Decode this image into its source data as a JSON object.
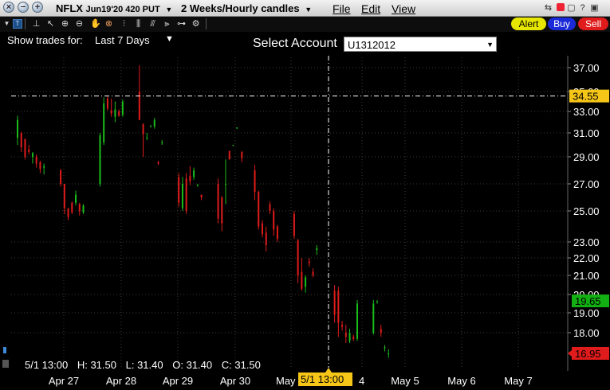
{
  "window": {
    "symbol": "NFLX",
    "contract": "Jun19'20 420 PUT",
    "period": "2 Weeks/Hourly candles",
    "menu": [
      "File",
      "Edit",
      "View"
    ]
  },
  "toolbar": {
    "tools": [
      "text-tool-icon",
      "pointer-icon",
      "zoom-in-icon",
      "zoom-out-icon",
      "hand-icon",
      "crosshair-icon",
      "bars-icon",
      "bars-alt-icon",
      "bars-scale-icon",
      "bars-fit-icon",
      "link-icon",
      "settings-icon"
    ],
    "alert_label": "Alert",
    "buy_label": "Buy",
    "sell_label": "Sell",
    "alert_color": "#e6e600",
    "buy_color": "#1b2ad8",
    "sell_color": "#e01b1b"
  },
  "header": {
    "show_trades_label": "Show trades for:",
    "trades_period": "Last 7 Days",
    "account_label": "Select Account",
    "account_value": "U1312012"
  },
  "crosshair": {
    "price_label": "34.55",
    "time_label": "5/1 13:00"
  },
  "price_badges": {
    "bid": "19.65",
    "bid_color": "#12b012",
    "ask": "16.95",
    "ask_color": "#e01b1b",
    "crosshair_color": "#f5c518"
  },
  "bottom_info": {
    "time": "5/1 13:00",
    "high": "H: 31.50",
    "low": "L: 31.40",
    "open": "O: 31.40",
    "close": "C: 31.50"
  },
  "chart_data": {
    "type": "candlestick",
    "y_ticks": [
      "37.00",
      "35.00",
      "33.00",
      "31.00",
      "29.00",
      "27.00",
      "25.00",
      "23.00",
      "22.00",
      "21.00",
      "20.00",
      "19.00",
      "18.00"
    ],
    "x_ticks": [
      "Apr 27",
      "Apr 28",
      "Apr 29",
      "Apr 30",
      "May",
      "4",
      "May 5",
      "May 6",
      "May 7"
    ],
    "ylim": [
      16.5,
      38.0
    ],
    "up_color": "#1bbd1b",
    "down_color": "#e01b1b",
    "candles": [
      {
        "x": 0.0,
        "o": 30.6,
        "h": 32.6,
        "l": 30.0,
        "c": 32.2
      },
      {
        "x": 0.007,
        "o": 31.0,
        "h": 31.1,
        "l": 29.4,
        "c": 29.8
      },
      {
        "x": 0.014,
        "o": 30.5,
        "h": 30.5,
        "l": 28.8,
        "c": 29.0
      },
      {
        "x": 0.021,
        "o": 29.6,
        "h": 30.0,
        "l": 29.2,
        "c": 29.4
      },
      {
        "x": 0.028,
        "o": 29.0,
        "h": 29.4,
        "l": 28.5,
        "c": 29.3
      },
      {
        "x": 0.035,
        "o": 29.0,
        "h": 29.2,
        "l": 28.2,
        "c": 28.5
      },
      {
        "x": 0.042,
        "o": 28.6,
        "h": 28.7,
        "l": 27.8,
        "c": 28.1
      },
      {
        "x": 0.049,
        "o": 28.2,
        "h": 28.5,
        "l": 27.7,
        "c": 28.3
      },
      {
        "x": 0.08,
        "o": 28.0,
        "h": 28.1,
        "l": 26.8,
        "c": 27.0
      },
      {
        "x": 0.087,
        "o": 27.0,
        "h": 27.0,
        "l": 24.8,
        "c": 25.2
      },
      {
        "x": 0.094,
        "o": 25.2,
        "h": 25.2,
        "l": 24.4,
        "c": 24.6
      },
      {
        "x": 0.101,
        "o": 25.6,
        "h": 25.7,
        "l": 24.8,
        "c": 24.9
      },
      {
        "x": 0.108,
        "o": 25.6,
        "h": 26.5,
        "l": 25.4,
        "c": 26.2
      },
      {
        "x": 0.115,
        "o": 25.5,
        "h": 25.6,
        "l": 24.7,
        "c": 25.0
      },
      {
        "x": 0.122,
        "o": 24.9,
        "h": 25.5,
        "l": 24.8,
        "c": 25.4
      },
      {
        "x": 0.153,
        "o": 27.0,
        "h": 31.0,
        "l": 26.8,
        "c": 30.8
      },
      {
        "x": 0.16,
        "o": 30.2,
        "h": 34.4,
        "l": 30.0,
        "c": 33.8
      },
      {
        "x": 0.167,
        "o": 34.3,
        "h": 34.5,
        "l": 33.1,
        "c": 33.3
      },
      {
        "x": 0.174,
        "o": 33.1,
        "h": 34.3,
        "l": 32.5,
        "c": 32.8
      },
      {
        "x": 0.181,
        "o": 32.5,
        "h": 34.0,
        "l": 32.0,
        "c": 33.2
      },
      {
        "x": 0.188,
        "o": 33.0,
        "h": 33.2,
        "l": 32.5,
        "c": 32.6
      },
      {
        "x": 0.195,
        "o": 32.7,
        "h": 34.2,
        "l": 32.5,
        "c": 34.0
      },
      {
        "x": 0.226,
        "o": 35.0,
        "h": 37.2,
        "l": 32.3,
        "c": 32.2
      },
      {
        "x": 0.233,
        "o": 31.8,
        "h": 31.9,
        "l": 29.0,
        "c": 30.9
      },
      {
        "x": 0.24,
        "o": 30.6,
        "h": 31.0,
        "l": 30.4,
        "c": 30.6
      },
      {
        "x": 0.247,
        "o": 31.7,
        "h": 31.7,
        "l": 31.5,
        "c": 31.7
      },
      {
        "x": 0.254,
        "o": 31.6,
        "h": 32.4,
        "l": 31.4,
        "c": 32.2
      },
      {
        "x": 0.261,
        "o": 28.6,
        "h": 28.7,
        "l": 28.4,
        "c": 28.5
      },
      {
        "x": 0.268,
        "o": 30.2,
        "h": 30.4,
        "l": 30.0,
        "c": 30.2
      },
      {
        "x": 0.299,
        "o": 27.5,
        "h": 27.8,
        "l": 25.3,
        "c": 25.6
      },
      {
        "x": 0.306,
        "o": 25.2,
        "h": 27.5,
        "l": 25.0,
        "c": 27.0
      },
      {
        "x": 0.313,
        "o": 27.4,
        "h": 27.8,
        "l": 24.8,
        "c": 25.0
      },
      {
        "x": 0.32,
        "o": 27.6,
        "h": 28.3,
        "l": 26.9,
        "c": 27.2
      },
      {
        "x": 0.327,
        "o": 27.5,
        "h": 28.2,
        "l": 27.3,
        "c": 28.0
      },
      {
        "x": 0.334,
        "o": 26.9,
        "h": 27.0,
        "l": 26.8,
        "c": 26.9
      },
      {
        "x": 0.341,
        "o": 26.2,
        "h": 26.2,
        "l": 25.8,
        "c": 26.0
      },
      {
        "x": 0.372,
        "o": 27.0,
        "h": 27.4,
        "l": 24.2,
        "c": 24.5
      },
      {
        "x": 0.379,
        "o": 26.0,
        "h": 26.1,
        "l": 23.7,
        "c": 24.2
      },
      {
        "x": 0.386,
        "o": 27.0,
        "h": 28.8,
        "l": 25.5,
        "c": 27.0
      },
      {
        "x": 0.393,
        "o": 29.5,
        "h": 29.5,
        "l": 28.8,
        "c": 28.8
      },
      {
        "x": 0.4,
        "o": 30.0,
        "h": 30.0,
        "l": 29.9,
        "c": 30.0
      },
      {
        "x": 0.407,
        "o": 31.4,
        "h": 31.5,
        "l": 31.4,
        "c": 31.5
      },
      {
        "x": 0.416,
        "o": 29.4,
        "h": 29.5,
        "l": 28.6,
        "c": 28.9
      },
      {
        "x": 0.44,
        "o": 28.0,
        "h": 28.4,
        "l": 25.8,
        "c": 26.4
      },
      {
        "x": 0.447,
        "o": 26.4,
        "h": 26.5,
        "l": 23.8,
        "c": 24.0
      },
      {
        "x": 0.454,
        "o": 24.2,
        "h": 24.4,
        "l": 23.3,
        "c": 23.5
      },
      {
        "x": 0.461,
        "o": 23.6,
        "h": 24.0,
        "l": 22.4,
        "c": 22.8
      },
      {
        "x": 0.468,
        "o": 25.5,
        "h": 25.7,
        "l": 24.8,
        "c": 25.0
      },
      {
        "x": 0.475,
        "o": 25.0,
        "h": 25.2,
        "l": 23.4,
        "c": 23.8
      },
      {
        "x": 0.482,
        "o": 24.0,
        "h": 24.1,
        "l": 23.0,
        "c": 23.2
      },
      {
        "x": 0.513,
        "o": 24.8,
        "h": 25.0,
        "l": 23.2,
        "c": 23.4
      },
      {
        "x": 0.52,
        "o": 23.1,
        "h": 23.2,
        "l": 20.6,
        "c": 21.0
      },
      {
        "x": 0.527,
        "o": 21.2,
        "h": 22.0,
        "l": 20.2,
        "c": 20.3
      },
      {
        "x": 0.534,
        "o": 20.4,
        "h": 21.0,
        "l": 20.1,
        "c": 20.9
      },
      {
        "x": 0.541,
        "o": 21.8,
        "h": 22.0,
        "l": 21.5,
        "c": 21.7
      },
      {
        "x": 0.548,
        "o": 21.2,
        "h": 21.4,
        "l": 20.9,
        "c": 21.0
      },
      {
        "x": 0.555,
        "o": 22.5,
        "h": 22.8,
        "l": 22.2,
        "c": 22.6
      },
      {
        "x": 0.588,
        "o": 20.2,
        "h": 20.5,
        "l": 18.5,
        "c": 18.9
      },
      {
        "x": 0.595,
        "o": 20.2,
        "h": 20.4,
        "l": 17.8,
        "c": 18.5
      },
      {
        "x": 0.602,
        "o": 18.4,
        "h": 18.6,
        "l": 18.1,
        "c": 18.3
      },
      {
        "x": 0.609,
        "o": 18.0,
        "h": 18.4,
        "l": 17.5,
        "c": 17.8
      },
      {
        "x": 0.616,
        "o": 17.6,
        "h": 18.2,
        "l": 17.5,
        "c": 18.0
      },
      {
        "x": 0.623,
        "o": 17.8,
        "h": 17.9,
        "l": 17.6,
        "c": 17.7
      },
      {
        "x": 0.63,
        "o": 17.7,
        "h": 19.7,
        "l": 17.6,
        "c": 19.5
      },
      {
        "x": 0.66,
        "o": 18.0,
        "h": 19.7,
        "l": 17.9,
        "c": 19.5
      },
      {
        "x": 0.667,
        "o": 19.6,
        "h": 19.7,
        "l": 19.5,
        "c": 19.6
      },
      {
        "x": 0.674,
        "o": 18.2,
        "h": 18.4,
        "l": 17.8,
        "c": 18.0
      },
      {
        "x": 0.681,
        "o": 17.3,
        "h": 17.4,
        "l": 17.1,
        "c": 17.3
      },
      {
        "x": 0.688,
        "o": 17.0,
        "h": 17.2,
        "l": 16.8,
        "c": 17.0
      }
    ]
  }
}
